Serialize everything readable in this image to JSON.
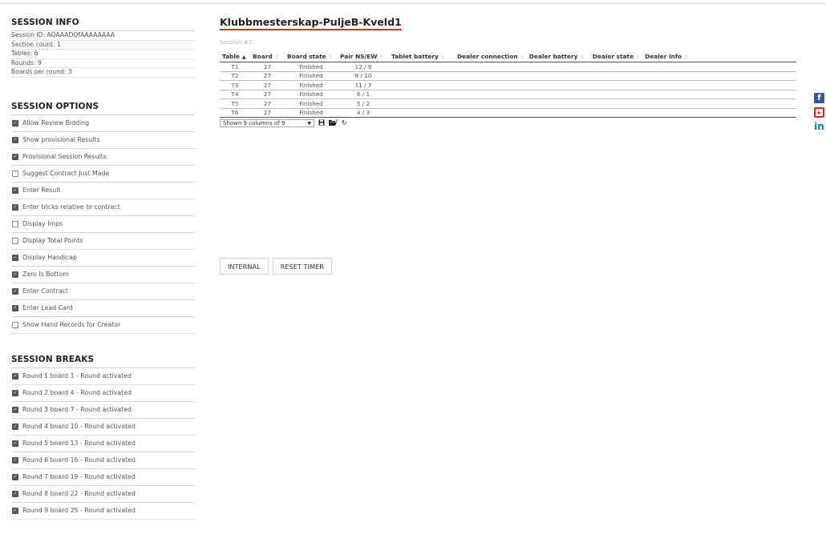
{
  "session_info": {
    "heading": "SESSION INFO",
    "rows": [
      "Session ID: AQAAADQfAAAAAAAA",
      "Section count: 1",
      "Tables: 6",
      "Rounds: 9",
      "Boards per round: 3"
    ]
  },
  "session_options": {
    "heading": "SESSION OPTIONS",
    "items": [
      {
        "label": "Allow Review Bidding",
        "checked": true
      },
      {
        "label": "Show provisional Results",
        "checked": true
      },
      {
        "label": "Provisional Session Results",
        "checked": true
      },
      {
        "label": "Suggest Contract Just Made",
        "checked": false
      },
      {
        "label": "Enter Result",
        "checked": true
      },
      {
        "label": "Enter tricks relative to contract",
        "checked": true
      },
      {
        "label": "Display Imps",
        "checked": false
      },
      {
        "label": "Display Total Points",
        "checked": false
      },
      {
        "label": "Display Handicap",
        "checked": true
      },
      {
        "label": "Zero Is Bottom",
        "checked": true
      },
      {
        "label": "Enter Contract",
        "checked": true
      },
      {
        "label": "Enter Lead Card",
        "checked": true
      },
      {
        "label": "Show Hand Records for Creator",
        "checked": false
      }
    ]
  },
  "session_breaks": {
    "heading": "SESSION BREAKS",
    "items": [
      {
        "label": "Round 1 board 1 - Round activated",
        "checked": true
      },
      {
        "label": "Round 2 board 4 - Round activated",
        "checked": true
      },
      {
        "label": "Round 3 board 7 - Round activated",
        "checked": true
      },
      {
        "label": "Round 4 board 10 - Round activated",
        "checked": true
      },
      {
        "label": "Round 5 board 13 - Round activated",
        "checked": true
      },
      {
        "label": "Round 6 board 16 - Round activated",
        "checked": true
      },
      {
        "label": "Round 7 board 19 - Round activated",
        "checked": true
      },
      {
        "label": "Round 8 board 22 - Round activated",
        "checked": true
      },
      {
        "label": "Round 9 board 25 - Round activated",
        "checked": true
      }
    ]
  },
  "main": {
    "title": "Klubbmesterskap-PuljeB-Kveld1",
    "session_label": "Session #1",
    "columns": [
      "Table",
      "Board",
      "Board state",
      "Pair NS/EW",
      "Tablet battery",
      "Dealer connection",
      "Dealer battery",
      "Dealer state",
      "Dealer info"
    ],
    "rows": [
      [
        "T1",
        "27",
        "Finished",
        "12 / 9",
        "",
        "",
        "",
        "",
        ""
      ],
      [
        "T2",
        "27",
        "Finished",
        "8 / 10",
        "",
        "",
        "",
        "",
        ""
      ],
      [
        "T3",
        "27",
        "Finished",
        "11 / 7",
        "",
        "",
        "",
        "",
        ""
      ],
      [
        "T4",
        "27",
        "Finished",
        "6 / 1",
        "",
        "",
        "",
        "",
        ""
      ],
      [
        "T5",
        "27",
        "Finished",
        "5 / 2",
        "",
        "",
        "",
        "",
        ""
      ],
      [
        "T6",
        "27",
        "Finished",
        "4 / 3",
        "",
        "",
        "",
        "",
        ""
      ]
    ],
    "column_selector": "Shown 9 columns of 9",
    "buttons": {
      "internal": "INTERNAL",
      "reset_timer": "RESET TIMER"
    }
  },
  "social": {
    "facebook_glyph": "f",
    "linkedin_glyph": "in"
  },
  "colors": {
    "title_underline": "#c0392b",
    "facebook": "#3b5998",
    "youtube": "#e62117",
    "linkedin": "#0e76a8"
  }
}
